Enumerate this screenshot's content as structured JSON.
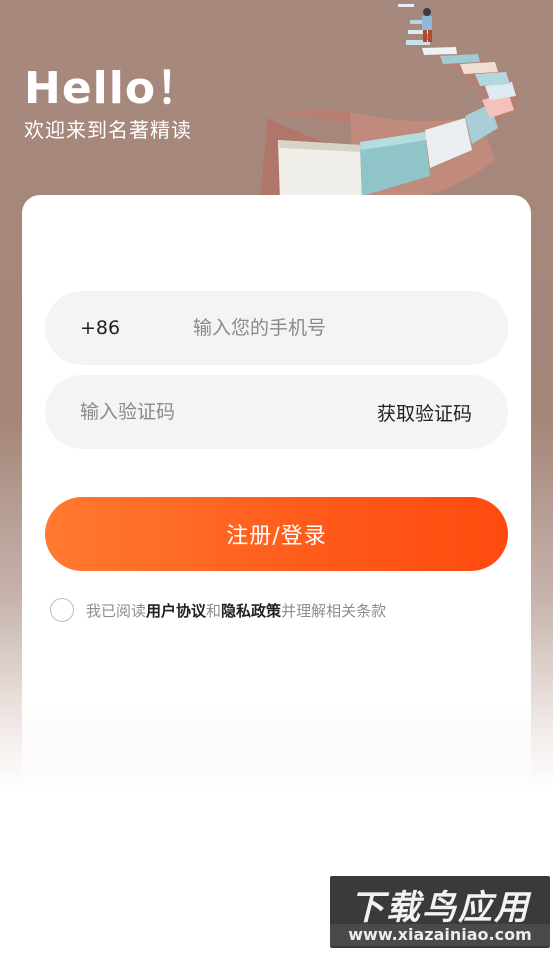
{
  "header": {
    "greeting": "Hello！",
    "subtitle": "欢迎来到名著精读"
  },
  "form": {
    "country_code": "+86",
    "phone_placeholder": "输入您的手机号",
    "phone_value": "",
    "code_placeholder": "输入验证码",
    "code_value": "",
    "get_code_label": "获取验证码",
    "submit_label": "注册/登录"
  },
  "agreement": {
    "checked": false,
    "prefix": "我已阅读",
    "user_agreement": "用户协议",
    "and": "和",
    "privacy_policy": "隐私政策",
    "suffix": "并理解相关条款"
  },
  "watermark": {
    "title": "下载鸟应用",
    "url": "www.xiazainiao.com"
  },
  "colors": {
    "background": "#a7887d",
    "accent_start": "#ff7a2e",
    "accent_end": "#ff4a0e",
    "field_bg": "#f4f4f4"
  }
}
